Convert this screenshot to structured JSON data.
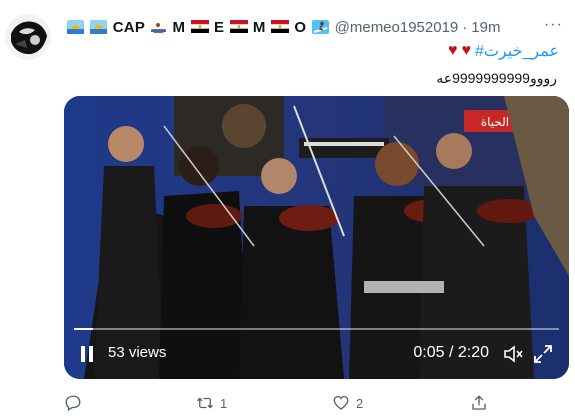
{
  "tweet": {
    "display_name_parts": [
      "CAP",
      "M",
      "E",
      "M",
      "O"
    ],
    "handle": "@memeo1952019",
    "separator": "·",
    "time": "19m",
    "more_label": "···",
    "hashtag": "#عمر_خيرت",
    "text_line2": "رووو9999999999عه"
  },
  "video": {
    "views": "53 views",
    "time": "0:05 / 2:20",
    "progress": 0.04,
    "overlay_logo": "الحياة"
  },
  "actions": {
    "reply_count": "",
    "retweet_count": "1",
    "like_count": "2",
    "share_count": ""
  },
  "colors": {
    "accent": "#1d9bf0",
    "heart": "#c2141b",
    "muted": "#536471"
  }
}
